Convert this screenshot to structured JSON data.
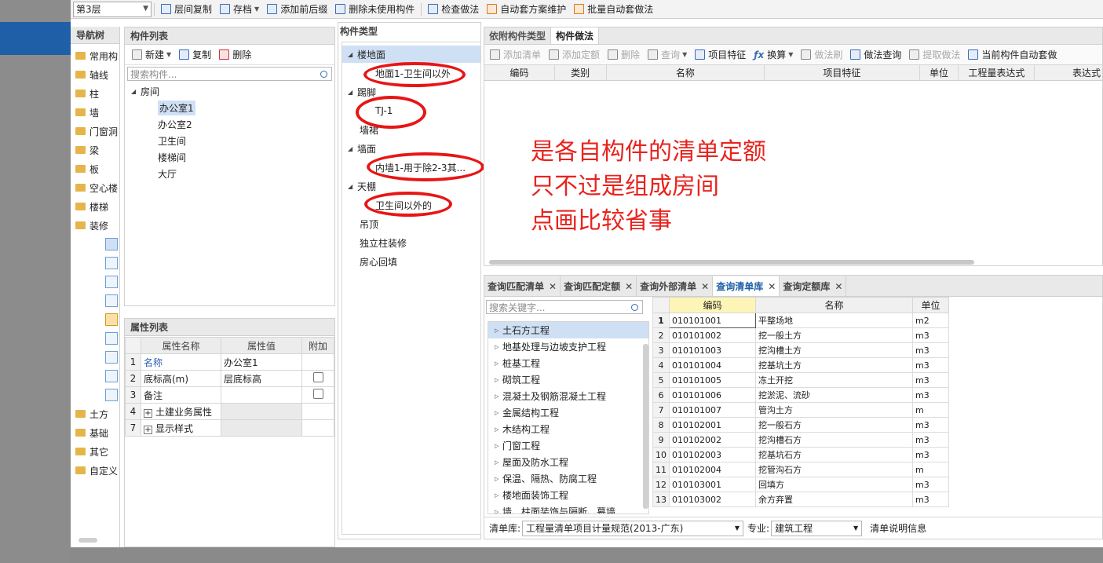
{
  "toolbar": {
    "floor": "第3层",
    "items": [
      {
        "label": "层间复制",
        "icon": "layer-copy-icon"
      },
      {
        "label": "存档",
        "icon": "save-icon",
        "dropdown": true
      },
      {
        "label": "添加前后缀",
        "icon": "prefix-icon"
      },
      {
        "label": "删除未使用构件",
        "icon": "delete-unused-icon"
      },
      {
        "label": "检查做法",
        "icon": "check-icon"
      },
      {
        "label": "自动套方案维护",
        "icon": "auto-scheme-icon"
      },
      {
        "label": "批量自动套做法",
        "icon": "batch-icon"
      }
    ]
  },
  "nav": {
    "title": "导航树",
    "items": [
      "常用构",
      "轴线",
      "柱",
      "墙",
      "门窗洞",
      "梁",
      "板",
      "空心楼",
      "楼梯",
      "装修"
    ],
    "items_after": [
      "土方",
      "基础",
      "其它",
      "自定义"
    ]
  },
  "component_list": {
    "title": "构件列表",
    "new_label": "新建",
    "copy_label": "复制",
    "delete_label": "删除",
    "search_placeholder": "搜索构件...",
    "root": "房间",
    "children": [
      "办公室1",
      "办公室2",
      "卫生间",
      "楼梯间",
      "大厅"
    ]
  },
  "props": {
    "title": "属性列表",
    "headers": [
      "属性名称",
      "属性值",
      "附加"
    ],
    "rows": [
      {
        "n": "1",
        "name": "名称",
        "value": "办公室1"
      },
      {
        "n": "2",
        "name": "底标高(m)",
        "value": "层底标高"
      },
      {
        "n": "3",
        "name": "备注",
        "value": ""
      },
      {
        "n": "4",
        "name": "土建业务属性",
        "value": ""
      },
      {
        "n": "7",
        "name": "显示样式",
        "value": ""
      }
    ]
  },
  "ctype": {
    "title": "构件类型",
    "groups": [
      {
        "label": "楼地面",
        "child": "地面1-卫生间以外"
      },
      {
        "label": "踢脚",
        "child": "TJ-1"
      },
      {
        "label": "墙裙",
        "child": ""
      },
      {
        "label": "墙面",
        "child": "内墙1-用于除2-3其..."
      },
      {
        "label": "天棚",
        "child": "卫生间以外的"
      },
      {
        "label": "吊顶",
        "child": ""
      },
      {
        "label": "独立柱装修",
        "child": ""
      },
      {
        "label": "房心回填",
        "child": ""
      }
    ]
  },
  "right": {
    "tabs": [
      "依附构件类型",
      "构件做法"
    ],
    "tools": [
      {
        "label": "添加清单",
        "dis": true
      },
      {
        "label": "添加定额",
        "dis": true
      },
      {
        "label": "删除",
        "dis": true
      },
      {
        "label": "查询",
        "dis": true,
        "dropdown": true
      },
      {
        "label": "项目特征",
        "dis": false
      },
      {
        "label": "换算",
        "dis": false,
        "dropdown": true
      },
      {
        "label": "做法刷",
        "dis": true
      },
      {
        "label": "做法查询",
        "dis": false
      },
      {
        "label": "提取做法",
        "dis": true
      },
      {
        "label": "当前构件自动套做",
        "dis": false
      }
    ],
    "headers": [
      "编码",
      "类别",
      "名称",
      "项目特征",
      "单位",
      "工程量表达式",
      "表达式"
    ]
  },
  "annotation": [
    "是各自构件的清单定额",
    "只不过是组成房间",
    "点画比较省事"
  ],
  "bottom": {
    "tabs": [
      "查询匹配清单",
      "查询匹配定额",
      "查询外部清单",
      "查询清单库",
      "查询定额库"
    ],
    "active_tab": 3,
    "search_placeholder": "搜索关键字...",
    "categories": [
      "土石方工程",
      "地基处理与边坡支护工程",
      "桩基工程",
      "砌筑工程",
      "混凝土及钢筋混凝土工程",
      "金属结构工程",
      "木结构工程",
      "门窗工程",
      "屋面及防水工程",
      "保温、隔热、防腐工程",
      "楼地面装饰工程",
      "墙、柱面装饰与隔断、幕墙..."
    ],
    "grid_headers": [
      "编码",
      "名称",
      "单位"
    ],
    "rows": [
      {
        "n": "1",
        "code": "010101001",
        "name": "平整场地",
        "unit": "m2"
      },
      {
        "n": "2",
        "code": "010101002",
        "name": "挖一般土方",
        "unit": "m3"
      },
      {
        "n": "3",
        "code": "010101003",
        "name": "挖沟槽土方",
        "unit": "m3"
      },
      {
        "n": "4",
        "code": "010101004",
        "name": "挖基坑土方",
        "unit": "m3"
      },
      {
        "n": "5",
        "code": "010101005",
        "name": "冻土开挖",
        "unit": "m3"
      },
      {
        "n": "6",
        "code": "010101006",
        "name": "挖淤泥、流砂",
        "unit": "m3"
      },
      {
        "n": "7",
        "code": "010101007",
        "name": "管沟土方",
        "unit": "m"
      },
      {
        "n": "8",
        "code": "010102001",
        "name": "挖一般石方",
        "unit": "m3"
      },
      {
        "n": "9",
        "code": "010102002",
        "name": "挖沟槽石方",
        "unit": "m3"
      },
      {
        "n": "10",
        "code": "010102003",
        "name": "挖基坑石方",
        "unit": "m3"
      },
      {
        "n": "11",
        "code": "010102004",
        "name": "挖管沟石方",
        "unit": "m"
      },
      {
        "n": "12",
        "code": "010103001",
        "name": "回填方",
        "unit": "m3"
      },
      {
        "n": "13",
        "code": "010103002",
        "name": "余方弃置",
        "unit": "m3"
      }
    ],
    "footer": {
      "lib_label": "清单库:",
      "lib_value": "工程量清单项目计量规范(2013-广东)",
      "spec_label": "专业:",
      "spec_value": "建筑工程",
      "desc_label": "清单说明信息"
    }
  }
}
